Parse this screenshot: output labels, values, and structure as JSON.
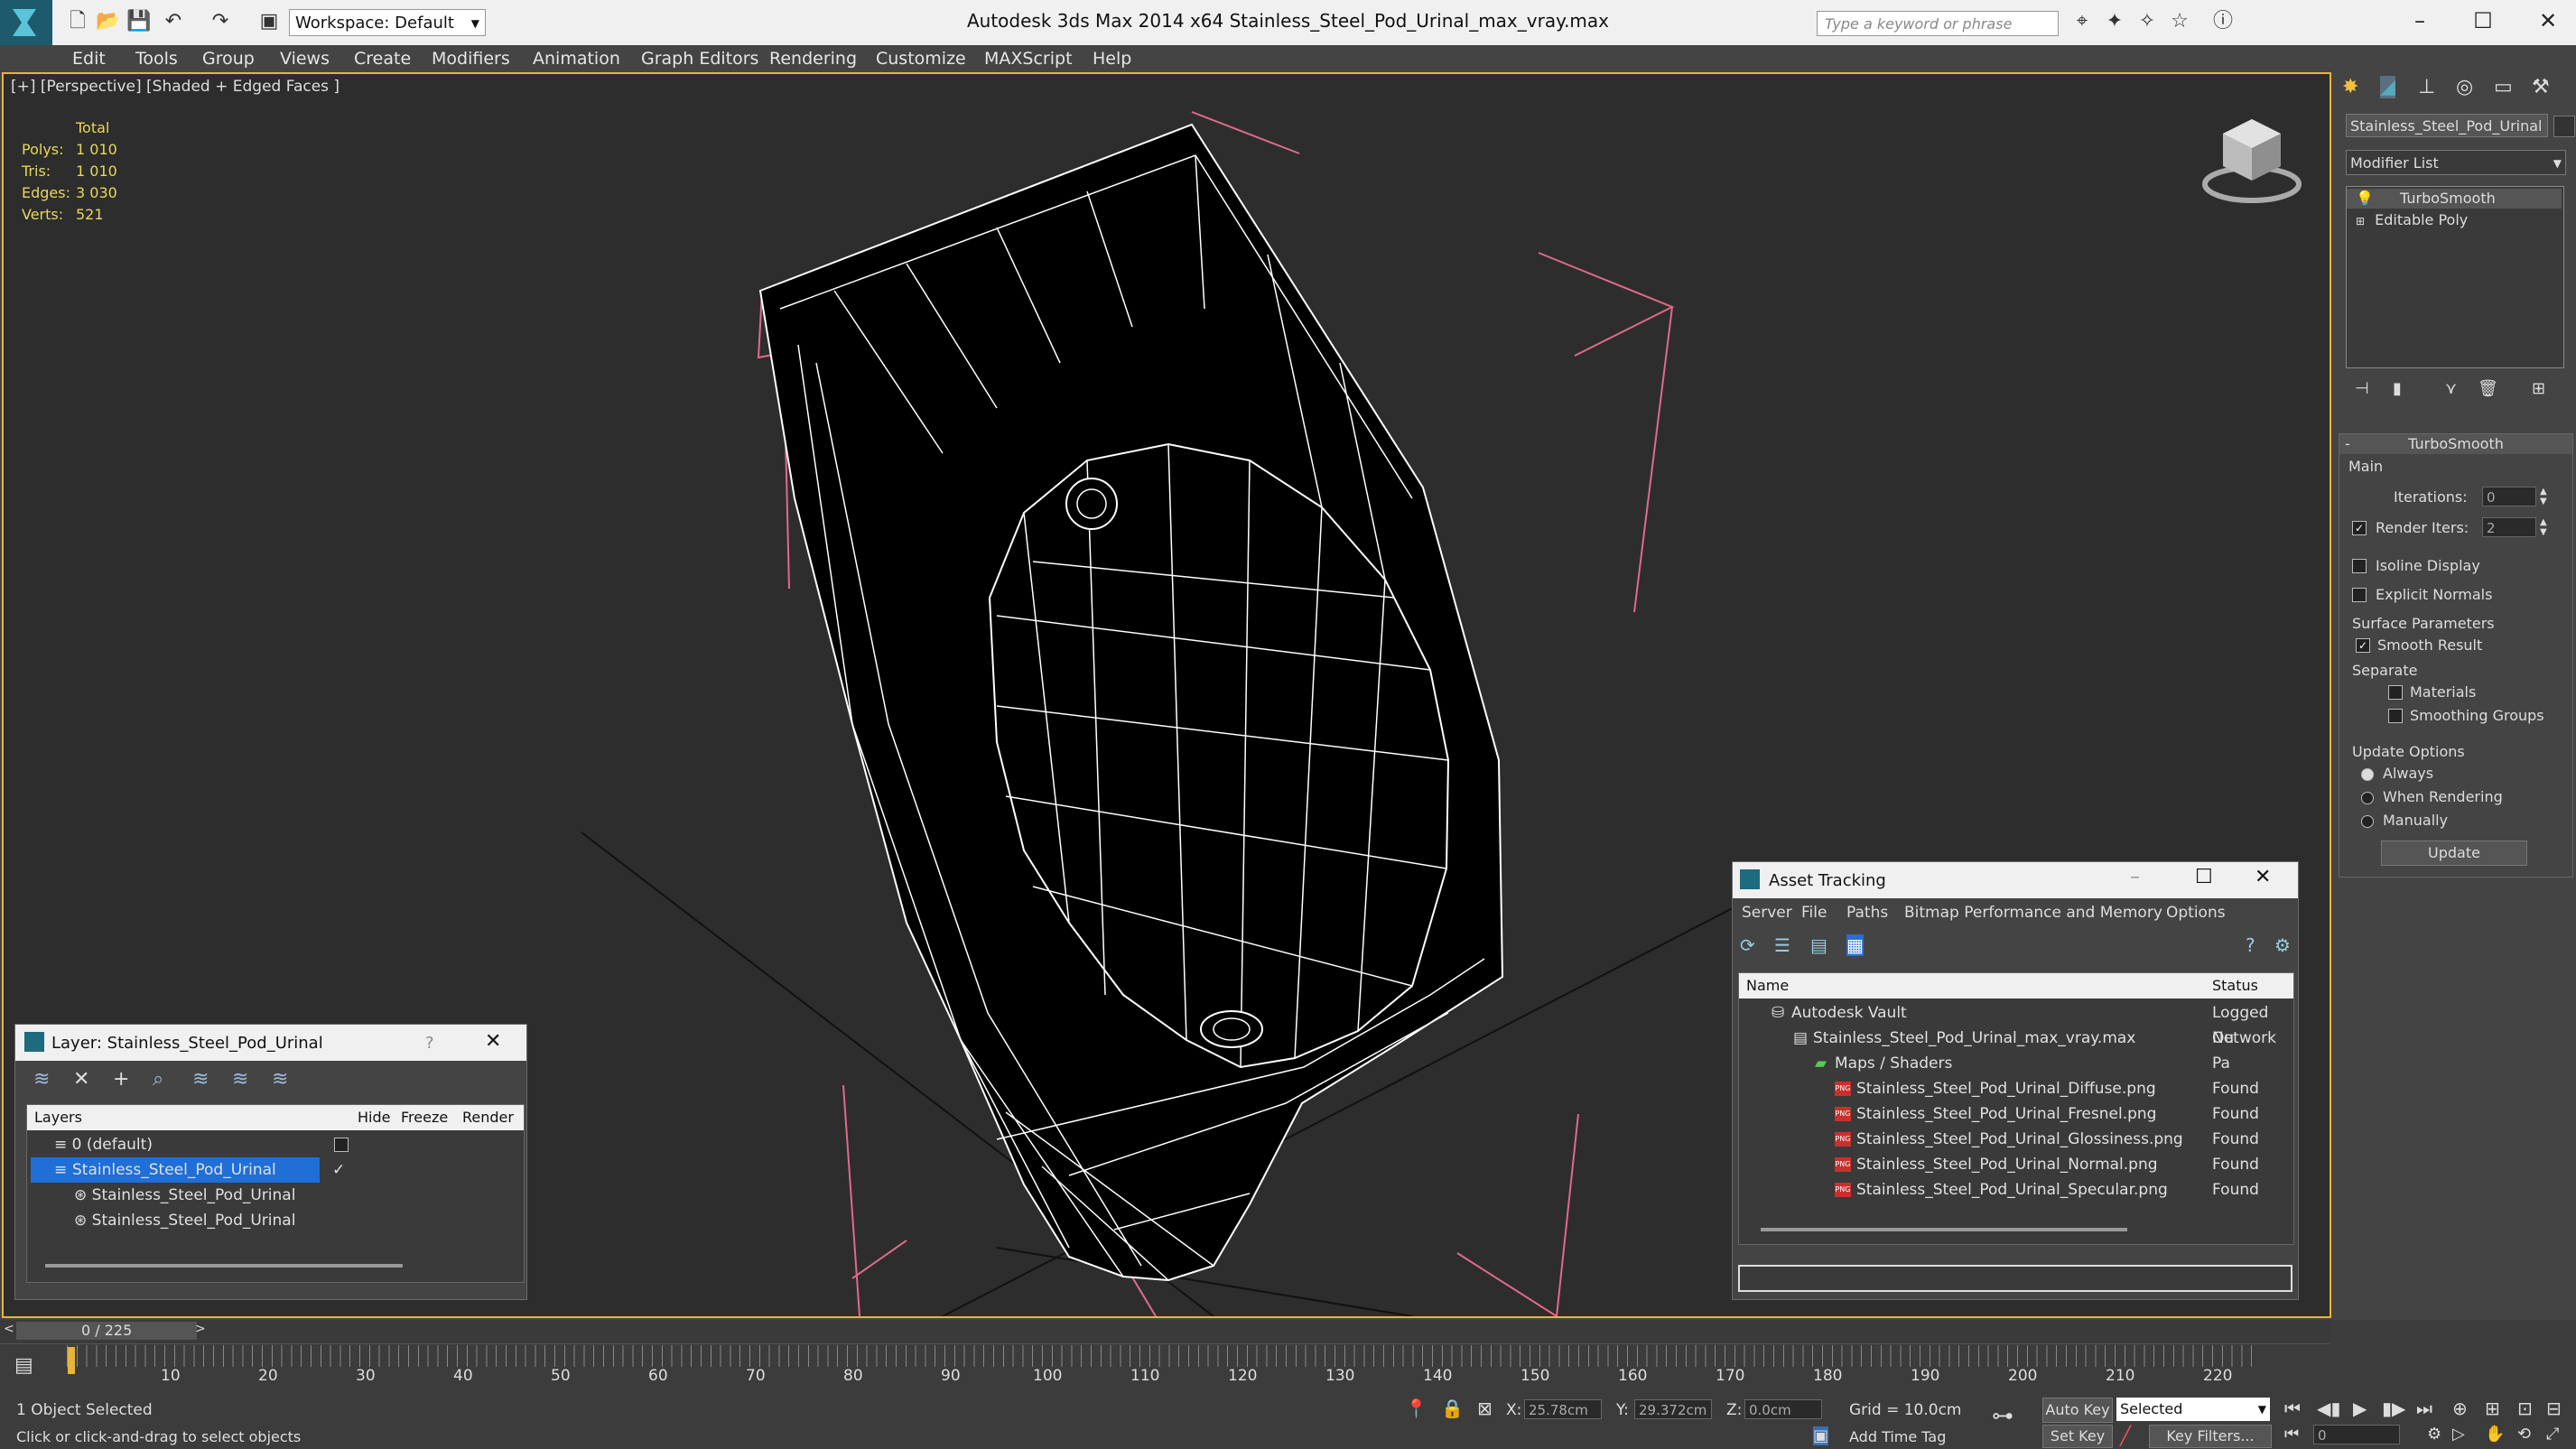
{
  "titlebar": {
    "title": "Autodesk 3ds Max  2014 x64      Stainless_Steel_Pod_Urinal_max_vray.max",
    "workspace": "Workspace: Default",
    "search_placeholder": "Type a keyword or phrase"
  },
  "menu": [
    "Edit",
    "Tools",
    "Group",
    "Views",
    "Create",
    "Modifiers",
    "Animation",
    "Graph Editors",
    "Rendering",
    "Customize",
    "MAXScript",
    "Help"
  ],
  "viewport": {
    "label": "[+] [Perspective] [Shaded + Edged Faces ]",
    "stats": {
      "header": "Total",
      "rows": [
        {
          "label": "Polys:",
          "value": "1 010"
        },
        {
          "label": "Tris:",
          "value": "1 010"
        },
        {
          "label": "Edges:",
          "value": "3 030"
        },
        {
          "label": "Verts:",
          "value": "521"
        }
      ]
    }
  },
  "command_panel": {
    "object_name": "Stainless_Steel_Pod_Urinal",
    "modifier_list": "Modifier List",
    "stack": [
      "TurboSmooth",
      "Editable Poly"
    ],
    "rollout_title": "TurboSmooth",
    "main_label": "Main",
    "iterations_label": "Iterations:",
    "iterations_value": "0",
    "render_iters_label": "Render Iters:",
    "render_iters_value": "2",
    "isoline": "Isoline Display",
    "explicit_normals": "Explicit Normals",
    "surface_params": "Surface Parameters",
    "smooth_result": "Smooth Result",
    "separate": "Separate",
    "materials": "Materials",
    "smoothing_groups": "Smoothing Groups",
    "update_options": "Update Options",
    "always": "Always",
    "when_rendering": "When Rendering",
    "manually": "Manually",
    "update_button": "Update"
  },
  "layer_panel": {
    "title": "Layer: Stainless_Steel_Pod_Urinal",
    "help": "?",
    "columns": [
      "Layers",
      "Hide",
      "Freeze",
      "Render"
    ],
    "rows": [
      "0 (default)",
      "Stainless_Steel_Pod_Urinal",
      "Stainless_Steel_Pod_Urinal",
      "Stainless_Steel_Pod_Urinal"
    ]
  },
  "asset_panel": {
    "title": "Asset Tracking",
    "menu": [
      "Server",
      "File",
      "Paths",
      "Bitmap Performance and Memory",
      "Options"
    ],
    "columns": [
      "Name",
      "Status"
    ],
    "rows": [
      {
        "name": "Autodesk Vault",
        "status": "Logged Ou"
      },
      {
        "name": "Stainless_Steel_Pod_Urinal_max_vray.max",
        "status": "Network Pa"
      },
      {
        "name": "Maps / Shaders",
        "status": ""
      },
      {
        "name": "Stainless_Steel_Pod_Urinal_Diffuse.png",
        "status": "Found"
      },
      {
        "name": "Stainless_Steel_Pod_Urinal_Fresnel.png",
        "status": "Found"
      },
      {
        "name": "Stainless_Steel_Pod_Urinal_Glossiness.png",
        "status": "Found"
      },
      {
        "name": "Stainless_Steel_Pod_Urinal_Normal.png",
        "status": "Found"
      },
      {
        "name": "Stainless_Steel_Pod_Urinal_Specular.png",
        "status": "Found"
      }
    ]
  },
  "timeline": {
    "frame": "0 / 225",
    "ticks": [
      "10",
      "20",
      "30",
      "40",
      "50",
      "60",
      "70",
      "80",
      "90",
      "100",
      "110",
      "120",
      "130",
      "140",
      "150",
      "160",
      "170",
      "180",
      "190",
      "200",
      "210",
      "220"
    ]
  },
  "status": {
    "selection": "1 Object Selected",
    "prompt": "Click or click-and-drag to select objects",
    "x_label": "X:",
    "x_value": "25.78cm",
    "y_label": "Y:",
    "y_value": "29.372cm",
    "z_label": "Z:",
    "z_value": "0.0cm",
    "grid": "Grid = 10.0cm",
    "add_time_tag": "Add Time Tag",
    "auto_key": "Auto Key",
    "set_key": "Set Key",
    "selected": "Selected",
    "key_filters": "Key Filters...",
    "frame_value": "0"
  }
}
